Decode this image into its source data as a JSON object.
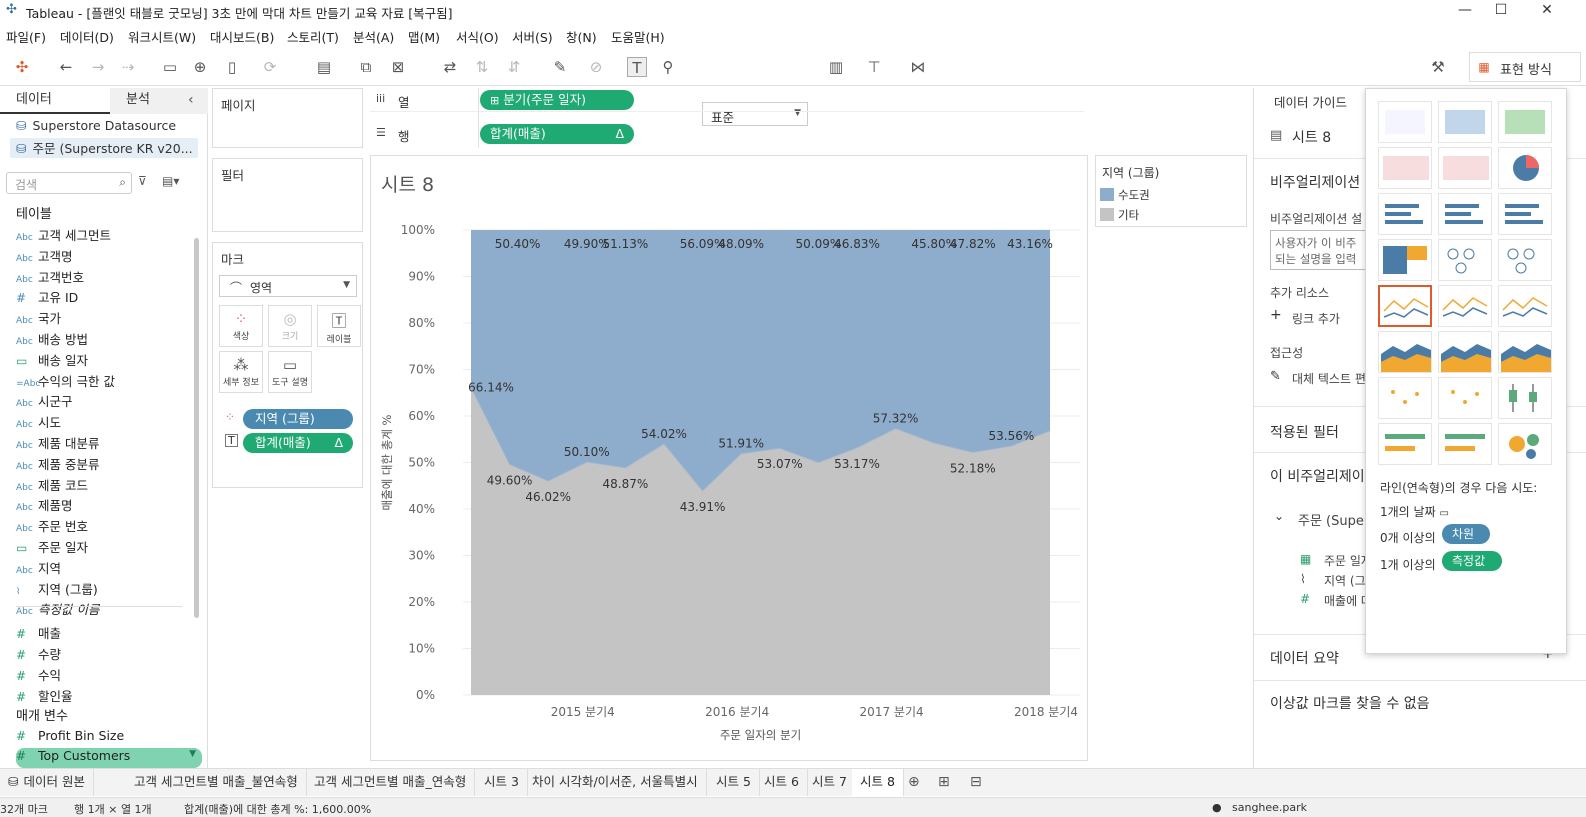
{
  "window": {
    "title": "Tableau - [플랜잇 태블로 굿모닝] 3초 만에 막대 차트 만들기 교육 자료 [복구됨]"
  },
  "menu": [
    "파일(F)",
    "데이터(D)",
    "워크시트(W)",
    "대시보드(B)",
    "스토리(T)",
    "분석(A)",
    "맵(M)",
    "서식(O)",
    "서버(S)",
    "창(N)",
    "도움말(H)"
  ],
  "toolbar": {
    "standard": "표준",
    "show_me": "표현 방식"
  },
  "left_pane": {
    "tab_data": "데이터",
    "tab_analytics": "분석",
    "datasources": [
      "Superstore Datasource",
      "주문 (Superstore KR v20..."
    ],
    "search_placeholder": "검색",
    "tables_header": "테이블",
    "fields": [
      {
        "type": "Abc",
        "name": "고객 세그먼트"
      },
      {
        "type": "Abc",
        "name": "고객명"
      },
      {
        "type": "Abc",
        "name": "고객번호"
      },
      {
        "type": "#",
        "name": "고유 ID"
      },
      {
        "type": "Abc",
        "name": "국가"
      },
      {
        "type": "Abc",
        "name": "배송 방법"
      },
      {
        "type": "date",
        "name": "배송 일자"
      },
      {
        "type": "=Abc",
        "name": "수익의 극한 값"
      },
      {
        "type": "Abc",
        "name": "시군구"
      },
      {
        "type": "Abc",
        "name": "시도"
      },
      {
        "type": "Abc",
        "name": "제품 대분류"
      },
      {
        "type": "Abc",
        "name": "제품 중분류"
      },
      {
        "type": "Abc",
        "name": "제품 코드"
      },
      {
        "type": "Abc",
        "name": "제품명"
      },
      {
        "type": "Abc",
        "name": "주문 번호"
      },
      {
        "type": "date",
        "name": "주문 일자"
      },
      {
        "type": "Abc",
        "name": "지역"
      },
      {
        "type": "clip",
        "name": "지역 (그룹)"
      },
      {
        "type": "Abc",
        "name": "측정값 이름"
      },
      {
        "type": "#",
        "name": "매출"
      },
      {
        "type": "#",
        "name": "수량"
      },
      {
        "type": "#",
        "name": "수익"
      },
      {
        "type": "#",
        "name": "할인율"
      }
    ],
    "params_header": "매개 변수",
    "params": [
      "Profit Bin Size",
      "Top Customers"
    ]
  },
  "shelves": {
    "pages": "페이지",
    "filters": "필터",
    "marks": "마크",
    "mark_type": "영역",
    "mark_buttons": [
      "색상",
      "크기",
      "레이블",
      "세부 정보",
      "도구 설명"
    ],
    "mark_pills": [
      "지역 (그룹)",
      "합계(매출)"
    ],
    "columns_label": "열",
    "rows_label": "행",
    "columns_pill": "분기(주문 일자)",
    "rows_pill": "합계(매출)",
    "delta": "Δ"
  },
  "sheet_title": "시트 8",
  "legend": {
    "title": "지역 (그룹)",
    "items": [
      {
        "name": "수도권",
        "color": "#8eaccb"
      },
      {
        "name": "기타",
        "color": "#c4c4c4"
      }
    ]
  },
  "chart_data": {
    "type": "area",
    "stacked_percent": true,
    "xlabel": "주문 일자의 분기",
    "ylabel": "매출에 대한 총계 %",
    "x_tick_labels": [
      "2015 분기4",
      "2016 분기4",
      "2017 분기4",
      "2018 분기4"
    ],
    "y_tick_labels": [
      "100%",
      "90%",
      "80%",
      "70%",
      "60%",
      "50%",
      "40%",
      "30%",
      "20%",
      "10%",
      "0%"
    ],
    "ylim": [
      0,
      100
    ],
    "n_quarters": 16,
    "series": [
      {
        "name": "기타",
        "color": "#c4c4c4",
        "values": [
          66.14,
          49.6,
          46.02,
          50.1,
          48.87,
          54.02,
          43.91,
          51.91,
          53.07,
          50.0,
          53.17,
          57.32,
          54.2,
          52.18,
          53.56,
          56.84
        ]
      },
      {
        "name": "수도권",
        "color": "#8eaccb",
        "values": [
          33.86,
          50.4,
          53.98,
          49.9,
          51.13,
          45.98,
          56.09,
          48.09,
          46.93,
          50.0,
          46.83,
          42.68,
          45.8,
          47.82,
          46.44,
          43.16
        ]
      }
    ],
    "top_labels": [
      "50.40%",
      "49.90%",
      "51.13%",
      "56.09%",
      "48.09%",
      "50.09%",
      "46.83%",
      "45.80%",
      "47.82%",
      "43.16%"
    ],
    "bottom_labels": [
      "66.14%",
      "49.60%",
      "46.02%",
      "50.10%",
      "48.87%",
      "54.02%",
      "43.91%",
      "51.91%",
      "53.07%",
      "53.17%",
      "57.32%",
      "52.18%",
      "53.56%"
    ]
  },
  "data_guide": {
    "header": "데이터 가이드",
    "sheet": "시트 8",
    "viz_header": "비주얼리제이션",
    "viz_desc_label": "비주얼리제이션 설",
    "viz_desc_placeholder": "사용자가 이 비주\n되는 설명을 입력",
    "resources": "추가 리소스",
    "add_link": "링크 추가",
    "accessibility": "접근성",
    "alt_text": "대체 텍스트 편",
    "applied_filters": "적용된 필터",
    "this_viz": "이 비주얼리제이",
    "source": "주문 (Supe",
    "fields": [
      "주문 일자",
      "지역 (그",
      "매출에 대"
    ],
    "data_summary": "데이터 요약",
    "outliers": "이상값 마크를 찾을 수 없음"
  },
  "show_me": {
    "hint": "라인(연속형)의 경우 다음 시도:",
    "row1": "1개의 날짜",
    "row2_prefix": "0개 이상의",
    "row2_pill": "차원",
    "row3_prefix": "1개 이상의",
    "row3_pill": "측정값"
  },
  "sheet_tabs": [
    "데이터 원본",
    "고객 세그먼트별 매출_불연속형",
    "고객 세그먼트별 매출_연속형",
    "시트 3",
    "차이 시각화/이서준, 서울특별시",
    "시트 5",
    "시트 6",
    "시트 7",
    "시트 8"
  ],
  "active_tab": "시트 8",
  "status": {
    "marks": "32개 마크",
    "rowscols": "행 1개 × 열 1개",
    "sum": "합계(매출)에 대한 총계 %: 1,600.00%",
    "user": "sanghee.park"
  }
}
